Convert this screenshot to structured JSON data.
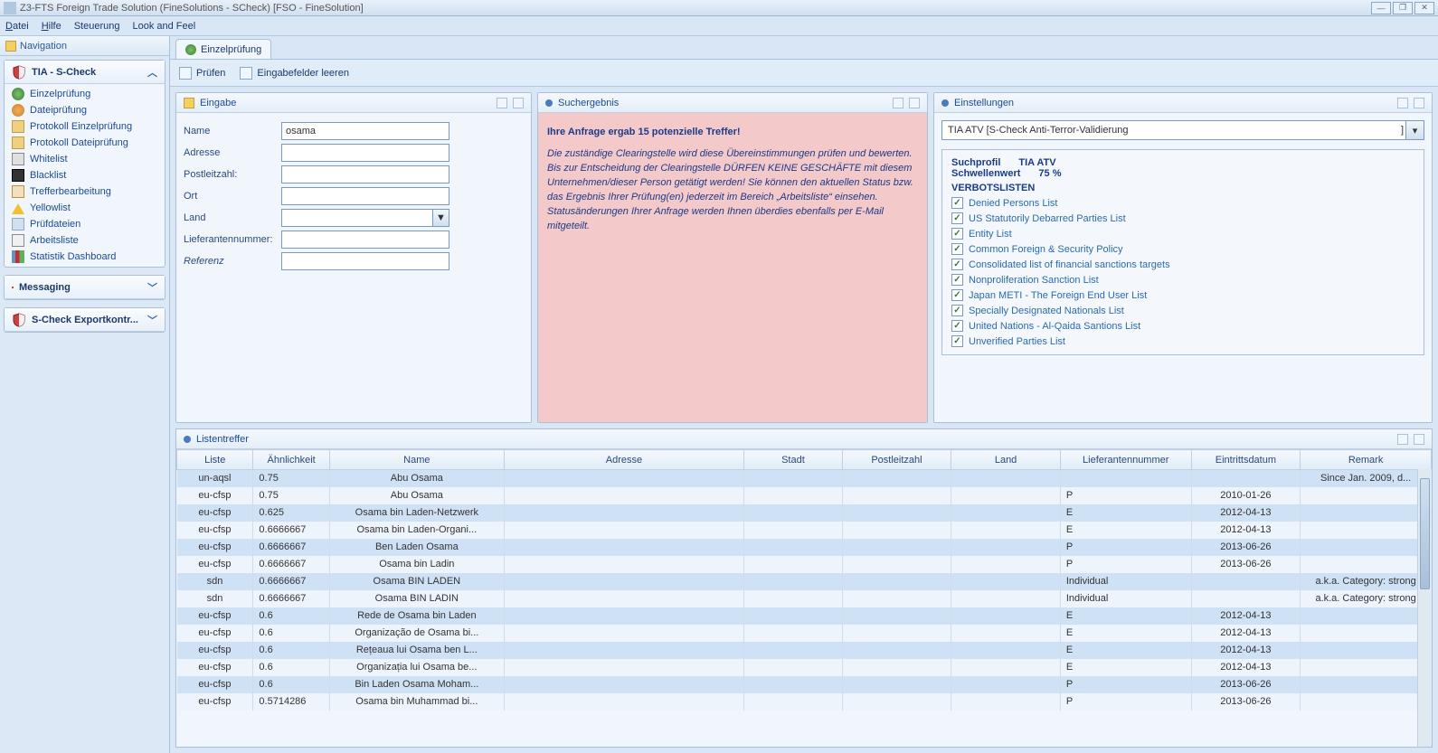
{
  "window": {
    "title": "Z3-FTS Foreign Trade Solution (FineSolutions - SCheck) [FSO - FineSolution]"
  },
  "menu": {
    "datei": "Datei",
    "hilfe": "Hilfe",
    "steuerung": "Steuerung",
    "lookfeel": "Look and Feel"
  },
  "nav": {
    "header": "Navigation",
    "section1": {
      "title": "TIA - S-Check",
      "items": [
        "Einzelprüfung",
        "Dateiprüfung",
        "Protokoll Einzelprüfung",
        "Protokoll Dateiprüfung",
        "Whitelist",
        "Blacklist",
        "Trefferbearbeitung",
        "Yellowlist",
        "Prüfdateien",
        "Arbeitsliste",
        "Statistik Dashboard"
      ]
    },
    "section2": {
      "title": "Messaging"
    },
    "section3": {
      "title": "S-Check Exportkontr..."
    }
  },
  "tab": {
    "label": "Einzelprüfung"
  },
  "toolbar": {
    "pruefen": "Prüfen",
    "leeren": "Eingabefelder leeren"
  },
  "eingabe": {
    "title": "Eingabe",
    "labels": {
      "name": "Name",
      "adresse": "Adresse",
      "plz": "Postleitzahl:",
      "ort": "Ort",
      "land": "Land",
      "liefer": "Lieferantennummer:",
      "referenz": "Referenz"
    },
    "values": {
      "name": "osama"
    }
  },
  "suchergebnis": {
    "title": "Suchergebnis",
    "headline": "Ihre Anfrage ergab 15 potenzielle Treffer!",
    "body": "Die zuständige Clearingstelle wird diese Übereinstimmungen prüfen und bewerten. Bis zur Entscheidung der Clearingstelle DÜRFEN KEINE GESCHÄFTE mit diesem Unternehmen/dieser Person getätigt werden! Sie können den aktuellen Status bzw. das Ergebnis Ihrer Prüfung(en) jederzeit im Bereich „Arbeitsliste“ einsehen. Statusänderungen Ihrer Anfrage werden Ihnen überdies ebenfalls per E-Mail mitgeteilt."
  },
  "einstellungen": {
    "title": "Einstellungen",
    "combo": "TIA ATV  [S-Check Anti-Terror-Validierung",
    "box": {
      "suchprofil_label": "Suchprofil",
      "suchprofil_value": "TIA ATV",
      "schwellen_label": "Schwellenwert",
      "schwellen_value": "75 %",
      "verbot": "VERBOTSLISTEN",
      "lists": [
        "Denied Persons List",
        "US Statutorily Debarred Parties List",
        "Entity List",
        "Common Foreign & Security Policy",
        "Consolidated list of financial sanctions targets",
        "Nonproliferation Sanction List",
        "Japan METI - The Foreign End User List",
        "Specially Designated Nationals List",
        "United Nations - Al-Qaida Santions List",
        "Unverified Parties List"
      ]
    }
  },
  "listentreffer": {
    "title": "Listentreffer",
    "columns": [
      "Liste",
      "Ähnlichkeit",
      "Name",
      "Adresse",
      "Stadt",
      "Postleitzahl",
      "Land",
      "Lieferantennummer",
      "Eintrittsdatum",
      "Remark"
    ],
    "rows": [
      {
        "liste": "un-aqsl",
        "aehn": "0.75",
        "name": "Abu Osama",
        "adr": "",
        "stadt": "",
        "plz": "",
        "land": "",
        "lief": "",
        "eintritt": "",
        "remark": "Since Jan. 2009, d..."
      },
      {
        "liste": "eu-cfsp",
        "aehn": "0.75",
        "name": "Abu Osama",
        "adr": "",
        "stadt": "",
        "plz": "",
        "land": "",
        "lief": "P",
        "eintritt": "2010-01-26",
        "remark": ""
      },
      {
        "liste": "eu-cfsp",
        "aehn": "0.625",
        "name": "Osama bin Laden-Netzwerk",
        "adr": "",
        "stadt": "",
        "plz": "",
        "land": "",
        "lief": "E",
        "eintritt": "2012-04-13",
        "remark": ""
      },
      {
        "liste": "eu-cfsp",
        "aehn": "0.6666667",
        "name": "Osama bin Laden-Organi...",
        "adr": "",
        "stadt": "",
        "plz": "",
        "land": "",
        "lief": "E",
        "eintritt": "2012-04-13",
        "remark": ""
      },
      {
        "liste": "eu-cfsp",
        "aehn": "0.6666667",
        "name": "Ben Laden Osama",
        "adr": "",
        "stadt": "",
        "plz": "",
        "land": "",
        "lief": "P",
        "eintritt": "2013-06-26",
        "remark": ""
      },
      {
        "liste": "eu-cfsp",
        "aehn": "0.6666667",
        "name": "Osama bin Ladin",
        "adr": "",
        "stadt": "",
        "plz": "",
        "land": "",
        "lief": "P",
        "eintritt": "2013-06-26",
        "remark": ""
      },
      {
        "liste": "sdn",
        "aehn": "0.6666667",
        "name": "Osama BIN LADEN",
        "adr": "",
        "stadt": "",
        "plz": "",
        "land": "",
        "lief": "Individual",
        "eintritt": "",
        "remark": "a.k.a. Category: strong"
      },
      {
        "liste": "sdn",
        "aehn": "0.6666667",
        "name": "Osama BIN LADIN",
        "adr": "",
        "stadt": "",
        "plz": "",
        "land": "",
        "lief": "Individual",
        "eintritt": "",
        "remark": "a.k.a. Category: strong"
      },
      {
        "liste": "eu-cfsp",
        "aehn": "0.6",
        "name": "Rede de Osama bin Laden",
        "adr": "",
        "stadt": "",
        "plz": "",
        "land": "",
        "lief": "E",
        "eintritt": "2012-04-13",
        "remark": ""
      },
      {
        "liste": "eu-cfsp",
        "aehn": "0.6",
        "name": "Organização de Osama bi...",
        "adr": "",
        "stadt": "",
        "plz": "",
        "land": "",
        "lief": "E",
        "eintritt": "2012-04-13",
        "remark": ""
      },
      {
        "liste": "eu-cfsp",
        "aehn": "0.6",
        "name": "Rețeaua lui Osama ben L...",
        "adr": "",
        "stadt": "",
        "plz": "",
        "land": "",
        "lief": "E",
        "eintritt": "2012-04-13",
        "remark": ""
      },
      {
        "liste": "eu-cfsp",
        "aehn": "0.6",
        "name": "Organizația lui Osama be...",
        "adr": "",
        "stadt": "",
        "plz": "",
        "land": "",
        "lief": "E",
        "eintritt": "2012-04-13",
        "remark": ""
      },
      {
        "liste": "eu-cfsp",
        "aehn": "0.6",
        "name": "Bin Laden Osama Moham...",
        "adr": "",
        "stadt": "",
        "plz": "",
        "land": "",
        "lief": "P",
        "eintritt": "2013-06-26",
        "remark": ""
      },
      {
        "liste": "eu-cfsp",
        "aehn": "0.5714286",
        "name": "Osama bin Muhammad bi...",
        "adr": "",
        "stadt": "",
        "plz": "",
        "land": "",
        "lief": "P",
        "eintritt": "2013-06-26",
        "remark": ""
      }
    ]
  }
}
